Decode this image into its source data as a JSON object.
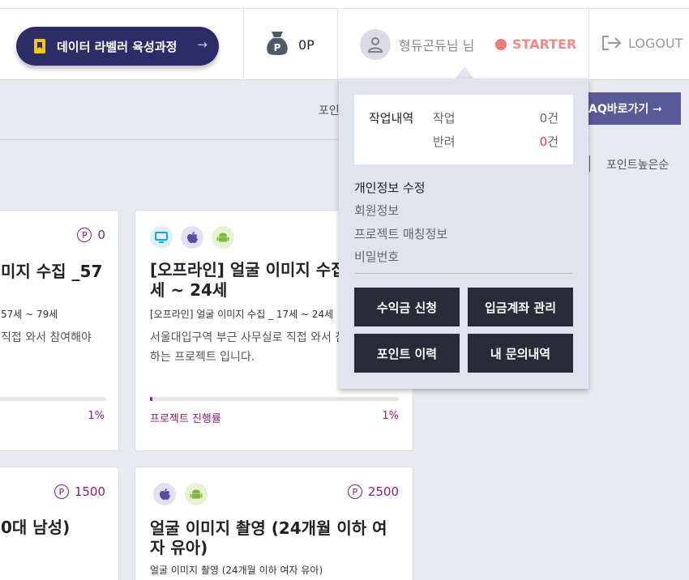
{
  "header": {
    "course_button": "데이터 라벨러 육성과정",
    "course_arrow": "→",
    "points": "0P",
    "user_name": "형듀곤듀님 님",
    "grade": "STARTER",
    "logout": "LOGOUT"
  },
  "toolbar": {
    "point_label": "포인",
    "faq_button": "AQ바로가기 ➞",
    "sort_label": "포인트높은순"
  },
  "cards": [
    {
      "points": "0",
      "title_1": "미지 수집 _57",
      "subtitle": "57세 ~ 79세",
      "desc_1": "직접 와서 참여해야",
      "progress_value": "1%",
      "progress_pct": 1
    },
    {
      "points": "",
      "title_1": "[오프라인] 얼굴 이미지 수집 _17",
      "title_2": "세 ~ 24세",
      "subtitle": "[오프라인] 얼굴 이미지 수집 _ 17세 ~ 24세",
      "desc_1": "서울대입구역 부근 사무실로 직접 와서 참여해야",
      "desc_2": "하는 프로젝트 입니다.",
      "progress_label": "프로젝트 진행률",
      "progress_value": "1%",
      "progress_pct": 1
    },
    {
      "points": "1500",
      "title_1": "0대 남성)"
    },
    {
      "points": "2500",
      "title_1": "얼굴 이미지 촬영 (24개월 이하 여",
      "title_2": "자 유아)",
      "subtitle": "얼굴 이미지 촬영 (24개월 이하 여자 유아)"
    }
  ],
  "point_symbol": "P",
  "dropdown": {
    "work_title": "작업내역",
    "work_label": "작업",
    "work_count": "0건",
    "reject_label": "반려",
    "reject_num": "0",
    "reject_unit": "건",
    "edit_title": "개인정보 수정",
    "links": [
      "회원정보",
      "프로젝트 매칭정보",
      "비밀번호"
    ],
    "buttons": [
      "수익금 신청",
      "입금계좌 관리",
      "포인트 이력",
      "내 문의내역"
    ]
  },
  "colors": {
    "brand_navy": "#2c2c66",
    "accent_purple": "#8e1c76",
    "grade_red": "#f07c76",
    "dark_button": "#272c38"
  }
}
